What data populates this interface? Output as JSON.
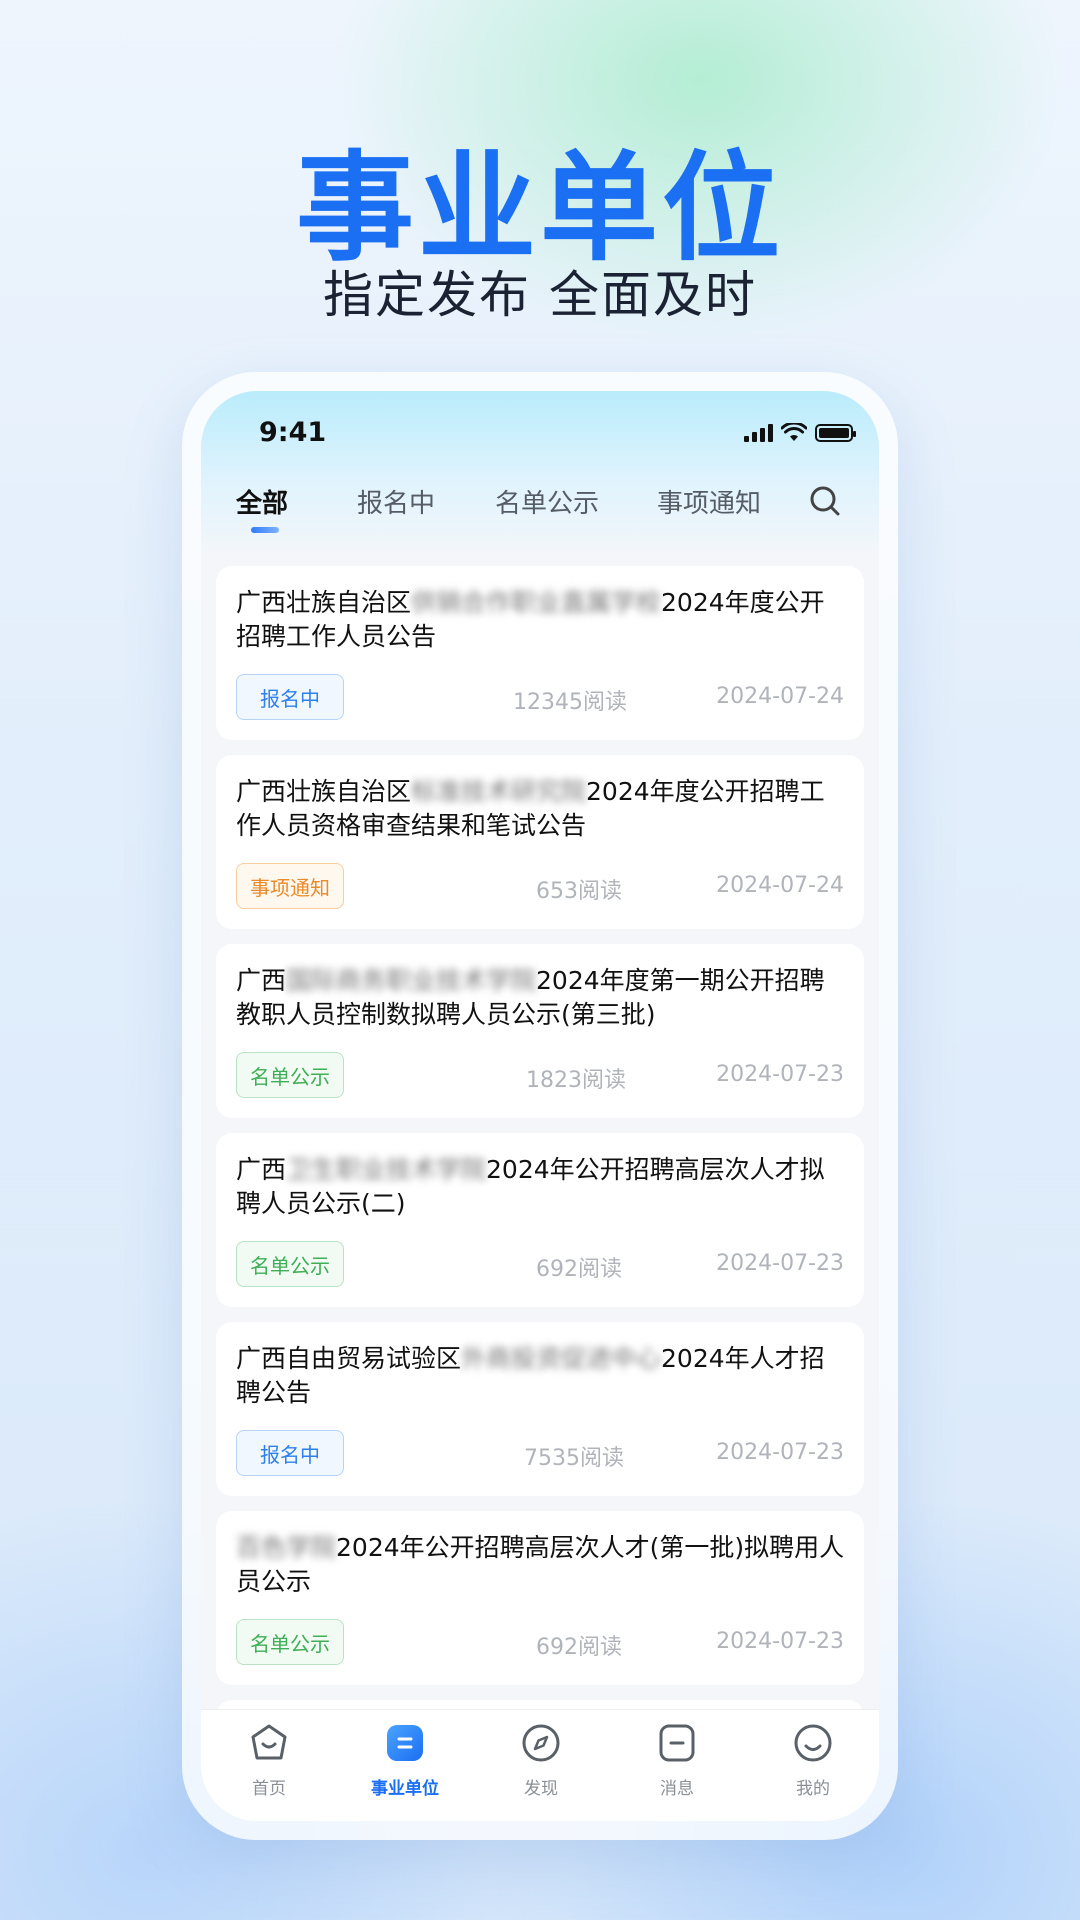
{
  "hero": {
    "title": "事业单位",
    "subtitle": "指定发布 全面及时"
  },
  "status_bar": {
    "time": "9:41"
  },
  "tabs": [
    {
      "label": "全部",
      "active": true
    },
    {
      "label": "报名中",
      "active": false
    },
    {
      "label": "名单公示",
      "active": false
    },
    {
      "label": "事项通知",
      "active": false
    }
  ],
  "cards": [
    {
      "prefix": "广西壮族自治区",
      "blurred": "供销合作职业直属学校",
      "suffix": "2024年度公开招聘工作人员公告",
      "badge": "报名中",
      "badge_color": "#2e80ea",
      "reads": "12345阅读",
      "date": "2024-07-24"
    },
    {
      "prefix": "广西壮族自治区",
      "blurred": "标准技术研究院",
      "suffix": "2024年度公开招聘工作人员资格审查结果和笔试公告",
      "badge": "事项通知",
      "badge_color": "#ea8a2a",
      "reads": "653阅读",
      "date": "2024-07-24"
    },
    {
      "prefix": "广西",
      "blurred": "国际商务职业技术学院",
      "suffix": "2024年度第一期公开招聘教职人员控制数拟聘人员公示(第三批)",
      "badge": "名单公示",
      "badge_color": "#3fae56",
      "reads": "1823阅读",
      "date": "2024-07-23"
    },
    {
      "prefix": "广西",
      "blurred": "卫生职业技术学院",
      "suffix": "2024年公开招聘高层次人才拟聘人员公示(二)",
      "badge": "名单公示",
      "badge_color": "#3fae56",
      "reads": "692阅读",
      "date": "2024-07-23"
    },
    {
      "prefix": "广西自由贸易试验区",
      "blurred": "外商投资促进中心",
      "suffix": "2024年人才招聘公告",
      "badge": "报名中",
      "badge_color": "#2e80ea",
      "reads": "7535阅读",
      "date": "2024-07-23"
    },
    {
      "prefix": "",
      "blurred": "百色学院",
      "suffix": "2024年公开招聘高层次人才(第一批)拟聘用人员公示",
      "badge": "名单公示",
      "badge_color": "#3fae56",
      "reads": "692阅读",
      "date": "2024-07-23"
    }
  ],
  "tabbar": [
    {
      "label": "首页",
      "icon": "home-icon",
      "active": false
    },
    {
      "label": "事业单位",
      "icon": "institution-icon",
      "active": true
    },
    {
      "label": "发现",
      "icon": "compass-icon",
      "active": false
    },
    {
      "label": "消息",
      "icon": "message-icon",
      "active": false
    },
    {
      "label": "我的",
      "icon": "profile-icon",
      "active": false
    }
  ],
  "colors": {
    "brand": "#1b6ff2",
    "badge_blue": "#2e80ea",
    "badge_orange": "#ea8a2a",
    "badge_green": "#3fae56"
  }
}
